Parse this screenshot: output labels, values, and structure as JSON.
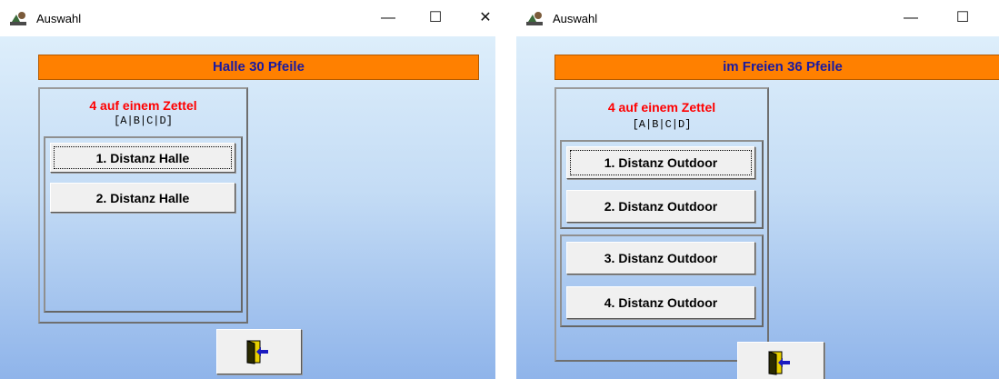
{
  "windows": [
    {
      "title": "Auswahl",
      "header": "Halle 30 Pfeile",
      "group_title": "4 auf einem Zettel",
      "group_sub": "[A|B|C|D]",
      "buttons": [
        "1. Distanz Halle",
        "2. Distanz Halle"
      ]
    },
    {
      "title": "Auswahl",
      "header": "im Freien 36 Pfeile",
      "group_title": "4 auf einem Zettel",
      "group_sub": "[A|B|C|D]",
      "buttons": [
        "1. Distanz Outdoor",
        "2. Distanz Outdoor",
        "3. Distanz Outdoor",
        "4. Distanz Outdoor"
      ]
    }
  ],
  "controls": {
    "minimize": "—",
    "maximize": "☐",
    "close": "✕"
  },
  "icons": {
    "app": "app-icon",
    "exit": "exit-door-icon"
  },
  "colors": {
    "header_bg": "#ff8000",
    "header_text": "#1a1aa0",
    "group_title": "#ff0000"
  }
}
